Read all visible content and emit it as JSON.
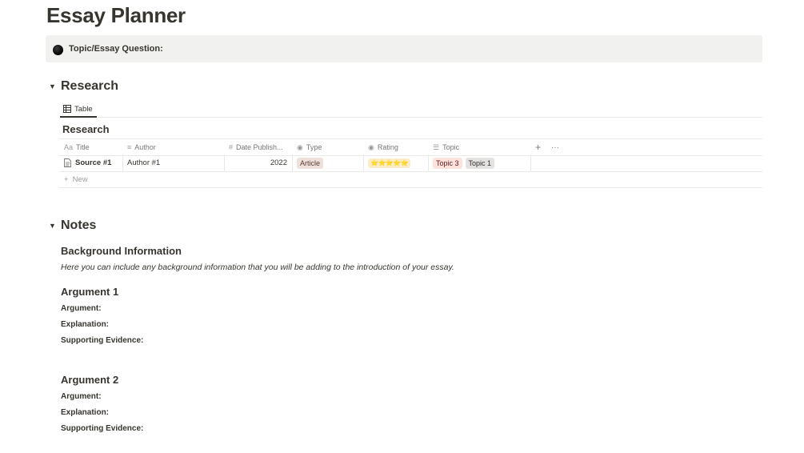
{
  "page": {
    "title": "Essay Planner"
  },
  "callout": {
    "icon": "black-circle",
    "text": "Topic/Essay Question:"
  },
  "research": {
    "heading": "Research",
    "view_tab": {
      "icon": "table-icon",
      "label": "Table"
    },
    "database_title": "Research",
    "columns": [
      {
        "icon": "text-icon",
        "label": "Title"
      },
      {
        "icon": "lines-icon",
        "label": "Author"
      },
      {
        "icon": "hash-icon",
        "label": "Date Publish..."
      },
      {
        "icon": "select-icon",
        "label": "Type"
      },
      {
        "icon": "select-icon",
        "label": "Rating"
      },
      {
        "icon": "list-icon",
        "label": "Topic"
      }
    ],
    "add_column_label": "+",
    "more_label": "···",
    "rows": [
      {
        "title": "Source #1",
        "author": "Author #1",
        "date": "2022",
        "type": "Article",
        "rating": "⭐⭐⭐⭐⭐",
        "topics": [
          "Topic 3",
          "Topic 1"
        ]
      }
    ],
    "new_label": "New",
    "colors": {
      "article": "#eee0da",
      "topic3": "#ffe2dd",
      "topic1": "#e3e2e0",
      "rating": "#fdecc8"
    }
  },
  "notes": {
    "heading": "Notes",
    "background": {
      "heading": "Background Information",
      "text": "Here you can include any background information that you will be adding to the introduction of your essay."
    },
    "argument1": {
      "heading": "Argument 1",
      "argument": "Argument:",
      "explanation": "Explanation:",
      "evidence": "Supporting Evidence:"
    },
    "argument2": {
      "heading": "Argument 2",
      "argument": "Argument:",
      "explanation": "Explanation:",
      "evidence": "Supporting Evidence:"
    }
  }
}
